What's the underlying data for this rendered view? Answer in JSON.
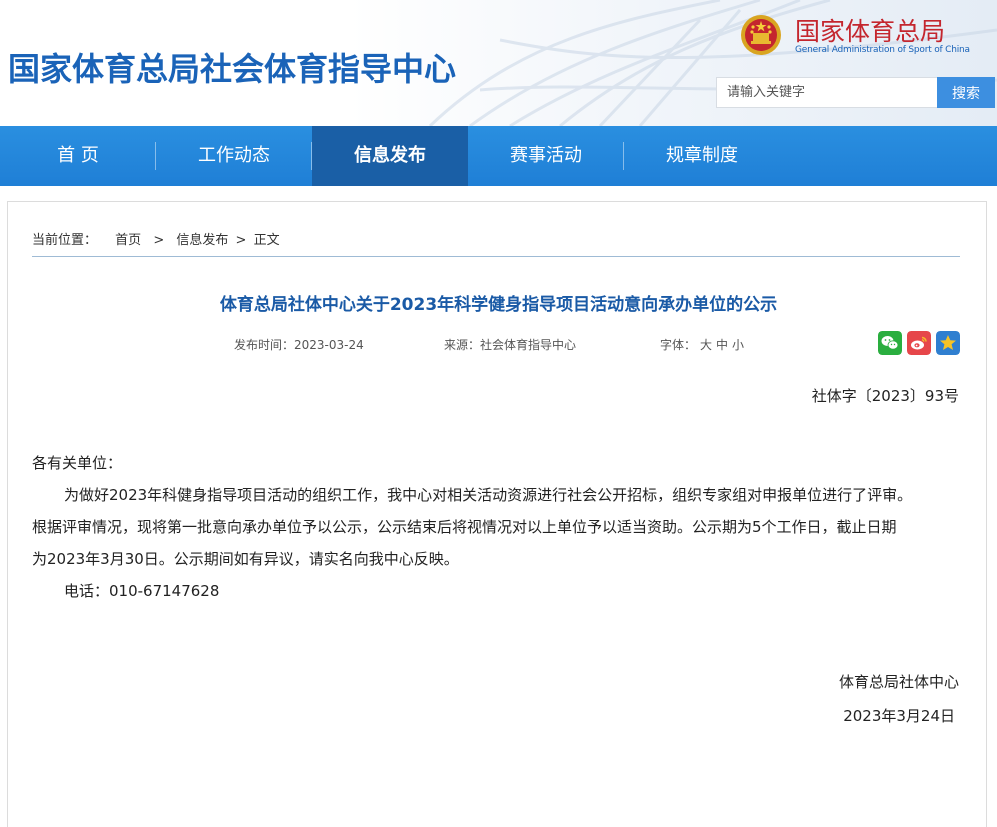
{
  "header": {
    "site_title": "国家体育总局社会体育指导中心",
    "org_name_cn": "国家体育总局",
    "org_name_en": "General Administration of Sport of China",
    "search_placeholder": "请输入关键字",
    "search_button": "搜索"
  },
  "nav": {
    "items": [
      {
        "label": "首 页"
      },
      {
        "label": "工作动态"
      },
      {
        "label": "信息发布",
        "active": true
      },
      {
        "label": "赛事活动"
      },
      {
        "label": "规章制度"
      }
    ]
  },
  "breadcrumb": {
    "prefix": "当前位置：",
    "home": "首页",
    "sep": ">",
    "section": "信息发布",
    "current": "正文"
  },
  "article": {
    "title": "体育总局社体中心关于2023年科学健身指导项目活动意向承办单位的公示",
    "publish_label": "发布时间：",
    "publish_date": "2023-03-24",
    "source_label": "来源：",
    "source": "社会体育指导中心",
    "font_label": "字体：",
    "font_large": "大",
    "font_medium": "中",
    "font_small": "小",
    "doc_number": "社体字〔2023〕93号",
    "salutation": "各有关单位：",
    "para1_line1": "为做好2023年科健身指导项目活动的组织工作，我中心对相关活动资源进行社会公开招标，组织专家组对申报单位进行了评审。",
    "para1_line2": "根据评审情况，现将第一批意向承办单位予以公示，公示结束后将视情况对以上单位予以适当资助。公示期为5个工作日，截止日期",
    "para1_line3": "为2023年3月30日。公示期间如有异议，请实名向我中心反映。",
    "phone": "电话：010-67147628",
    "sign_org": "体育总局社体中心",
    "sign_date": "2023年3月24日"
  },
  "colors": {
    "brand_blue": "#1a63b8",
    "nav_blue": "#1f7fd6",
    "nav_active": "#1a5fa6",
    "org_red": "#c4262e",
    "search_button": "#3d8fe0"
  },
  "icons": [
    "national-emblem-icon",
    "wechat-icon",
    "weibo-icon",
    "star-icon"
  ]
}
